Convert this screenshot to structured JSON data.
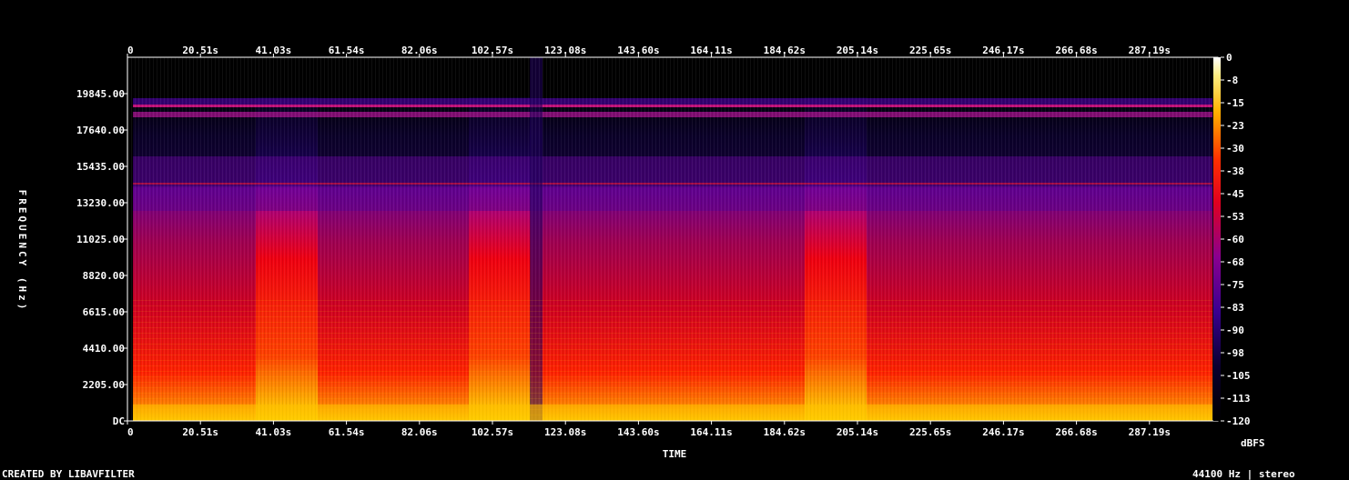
{
  "chart_data": {
    "type": "heatmap",
    "title": "",
    "xlabel": "TIME",
    "ylabel": "FREQUENCY (Hz)",
    "x_ticks": [
      "0",
      "20.51s",
      "41.03s",
      "61.54s",
      "82.06s",
      "102.57s",
      "123.08s",
      "143.60s",
      "164.11s",
      "184.62s",
      "205.14s",
      "225.65s",
      "246.17s",
      "266.68s",
      "287.19s"
    ],
    "y_ticks": [
      "DC",
      "2205.00",
      "4410.00",
      "6615.00",
      "8820.00",
      "11025.00",
      "13230.00",
      "15435.00",
      "17640.00",
      "19845.00"
    ],
    "colorbar_label": "dBFS",
    "colorbar_ticks": [
      "0",
      "-8",
      "-15",
      "-23",
      "-30",
      "-38",
      "-45",
      "-53",
      "-60",
      "-68",
      "-75",
      "-83",
      "-90",
      "-98",
      "-105",
      "-113",
      "-120"
    ],
    "colorbar_range": [
      -120,
      0
    ],
    "colormap": "intensity",
    "colors": {
      "background": "#000000",
      "text": "#ffffff",
      "low": "#000000",
      "mid_low": "#200070",
      "mid": "#8000a0",
      "mid_high": "#ff0000",
      "high": "#ffd000",
      "peak": "#ffffff"
    }
  },
  "footer": {
    "credit": "CREATED BY LIBAVFILTER",
    "sample_info": "44100 Hz | stereo"
  }
}
